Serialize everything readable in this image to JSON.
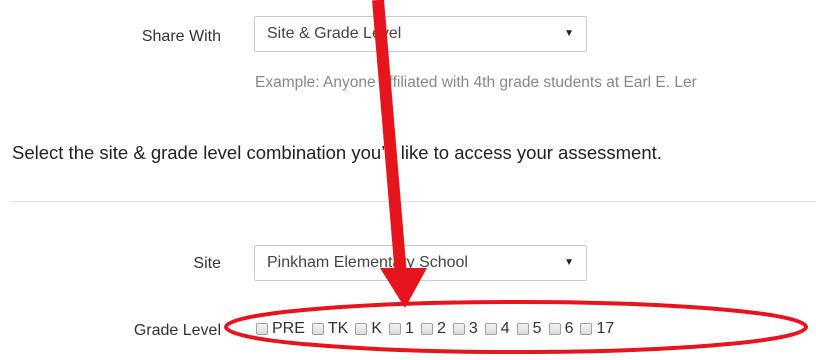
{
  "share": {
    "label": "Share With",
    "selected": "Site & Grade Level",
    "help": "Example: Anyone affiliated with 4th grade students at Earl E. Ler"
  },
  "section_heading": "Select the site & grade level combination you’d like to access your assessment.",
  "site": {
    "label": "Site",
    "selected": "Pinkham Elementary School"
  },
  "grade_level": {
    "label": "Grade Level",
    "options": [
      "PRE",
      "TK",
      "K",
      "1",
      "2",
      "3",
      "4",
      "5",
      "6",
      "17"
    ]
  },
  "colors": {
    "annotation": "#e8141c"
  }
}
